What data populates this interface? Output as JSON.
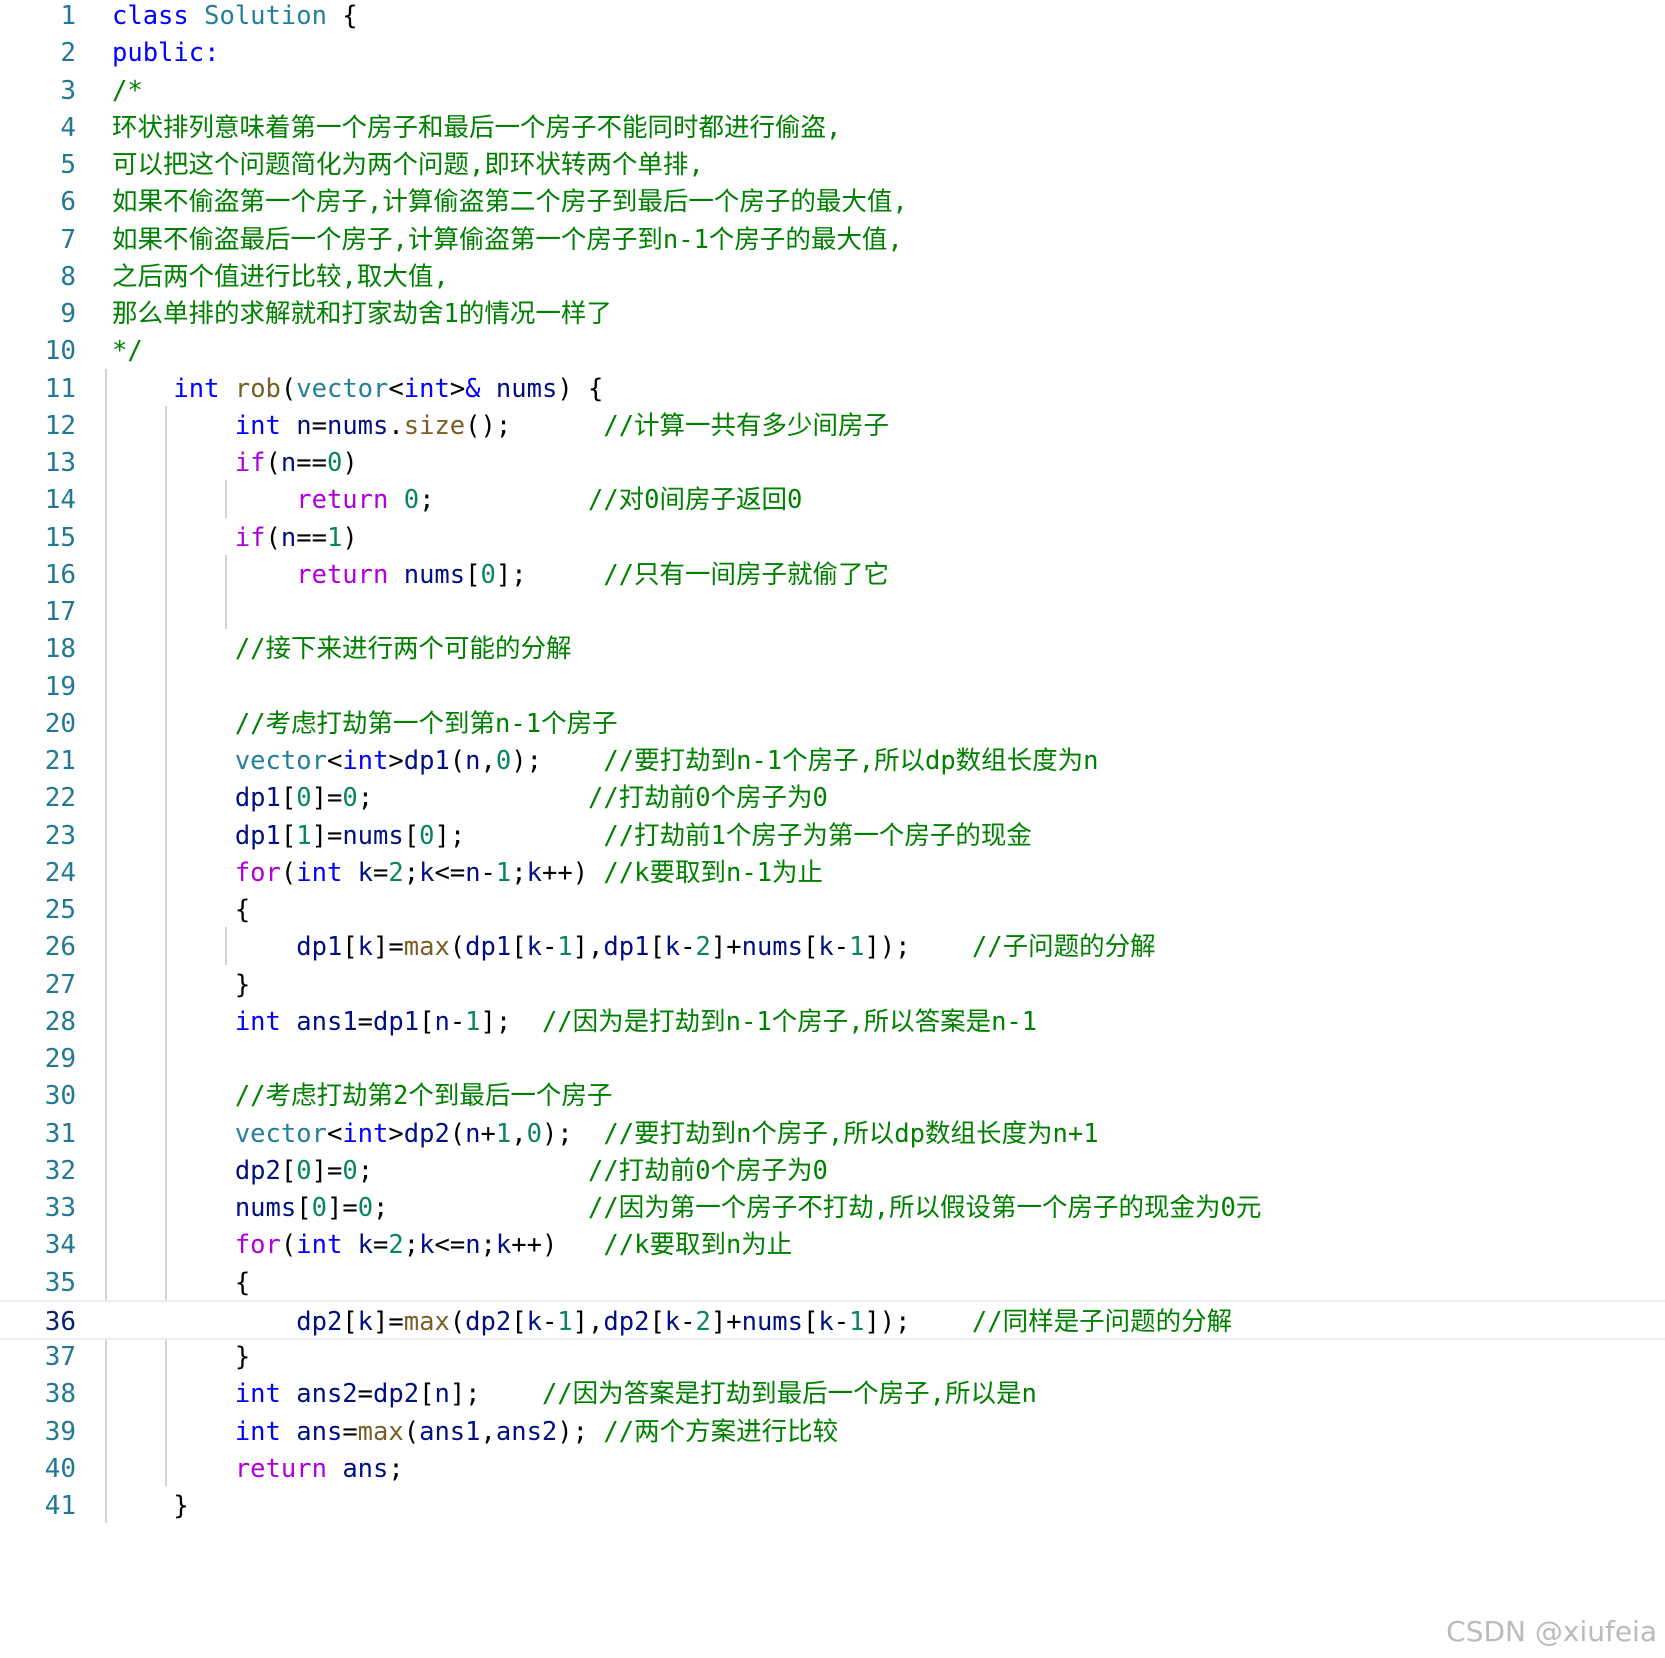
{
  "colors": {
    "keyword": "#0000ff",
    "control": "#af00db",
    "comment": "#008000",
    "type": "#267f99",
    "function": "#795e26",
    "number": "#098658",
    "variable": "#001080",
    "line_number": "#237893"
  },
  "active_line": 36,
  "watermark": "CSDN @xiufeia",
  "lines": [
    {
      "n": "1",
      "tokens": [
        [
          "kw",
          "class"
        ],
        [
          "plain",
          " "
        ],
        [
          "ty",
          "Solution"
        ],
        [
          "plain",
          " {"
        ]
      ]
    },
    {
      "n": "2",
      "tokens": [
        [
          "kw",
          "public:"
        ]
      ]
    },
    {
      "n": "3",
      "tokens": [
        [
          "cm",
          "/*"
        ]
      ]
    },
    {
      "n": "4",
      "tokens": [
        [
          "cm",
          "环状排列意味着第一个房子和最后一个房子不能同时都进行偷盗,"
        ]
      ]
    },
    {
      "n": "5",
      "tokens": [
        [
          "cm",
          "可以把这个问题简化为两个问题,即环状转两个单排,"
        ]
      ]
    },
    {
      "n": "6",
      "tokens": [
        [
          "cm",
          "如果不偷盗第一个房子,计算偷盗第二个房子到最后一个房子的最大值,"
        ]
      ]
    },
    {
      "n": "7",
      "tokens": [
        [
          "cm",
          "如果不偷盗最后一个房子,计算偷盗第一个房子到n-1个房子的最大值,"
        ]
      ]
    },
    {
      "n": "8",
      "tokens": [
        [
          "cm",
          "之后两个值进行比较,取大值,"
        ]
      ]
    },
    {
      "n": "9",
      "tokens": [
        [
          "cm",
          "那么单排的求解就和打家劫舍1的情况一样了"
        ]
      ]
    },
    {
      "n": "10",
      "tokens": [
        [
          "cm",
          "*/"
        ]
      ]
    },
    {
      "n": "11",
      "tokens": [
        [
          "plain",
          "    "
        ],
        [
          "kw",
          "int"
        ],
        [
          "plain",
          " "
        ],
        [
          "fn",
          "rob"
        ],
        [
          "plain",
          "("
        ],
        [
          "ty",
          "vector"
        ],
        [
          "plain",
          "<"
        ],
        [
          "kw",
          "int"
        ],
        [
          "plain",
          ">"
        ],
        [
          "kw",
          "&"
        ],
        [
          "plain",
          " "
        ],
        [
          "var",
          "nums"
        ],
        [
          "plain",
          ") {"
        ]
      ]
    },
    {
      "n": "12",
      "tokens": [
        [
          "plain",
          "        "
        ],
        [
          "kw",
          "int"
        ],
        [
          "plain",
          " "
        ],
        [
          "var",
          "n"
        ],
        [
          "plain",
          "="
        ],
        [
          "var",
          "nums"
        ],
        [
          "plain",
          "."
        ],
        [
          "fn",
          "size"
        ],
        [
          "plain",
          "();      "
        ],
        [
          "cm",
          "//计算一共有多少间房子"
        ]
      ]
    },
    {
      "n": "13",
      "tokens": [
        [
          "plain",
          "        "
        ],
        [
          "ctl",
          "if"
        ],
        [
          "plain",
          "("
        ],
        [
          "var",
          "n"
        ],
        [
          "plain",
          "=="
        ],
        [
          "num",
          "0"
        ],
        [
          "plain",
          ")"
        ]
      ]
    },
    {
      "n": "14",
      "tokens": [
        [
          "plain",
          "            "
        ],
        [
          "ctl",
          "return"
        ],
        [
          "plain",
          " "
        ],
        [
          "num",
          "0"
        ],
        [
          "plain",
          ";          "
        ],
        [
          "cm",
          "//对0间房子返回0"
        ]
      ]
    },
    {
      "n": "15",
      "tokens": [
        [
          "plain",
          "        "
        ],
        [
          "ctl",
          "if"
        ],
        [
          "plain",
          "("
        ],
        [
          "var",
          "n"
        ],
        [
          "plain",
          "=="
        ],
        [
          "num",
          "1"
        ],
        [
          "plain",
          ")"
        ]
      ]
    },
    {
      "n": "16",
      "tokens": [
        [
          "plain",
          "            "
        ],
        [
          "ctl",
          "return"
        ],
        [
          "plain",
          " "
        ],
        [
          "var",
          "nums"
        ],
        [
          "plain",
          "["
        ],
        [
          "num",
          "0"
        ],
        [
          "plain",
          "];     "
        ],
        [
          "cm",
          "//只有一间房子就偷了它"
        ]
      ]
    },
    {
      "n": "17",
      "tokens": []
    },
    {
      "n": "18",
      "tokens": [
        [
          "plain",
          "        "
        ],
        [
          "cm",
          "//接下来进行两个可能的分解"
        ]
      ]
    },
    {
      "n": "19",
      "tokens": []
    },
    {
      "n": "20",
      "tokens": [
        [
          "plain",
          "        "
        ],
        [
          "cm",
          "//考虑打劫第一个到第n-1个房子"
        ]
      ]
    },
    {
      "n": "21",
      "tokens": [
        [
          "plain",
          "        "
        ],
        [
          "ty",
          "vector"
        ],
        [
          "plain",
          "<"
        ],
        [
          "kw",
          "int"
        ],
        [
          "plain",
          ">"
        ],
        [
          "var",
          "dp1"
        ],
        [
          "plain",
          "("
        ],
        [
          "var",
          "n"
        ],
        [
          "plain",
          ","
        ],
        [
          "num",
          "0"
        ],
        [
          "plain",
          ");    "
        ],
        [
          "cm",
          "//要打劫到n-1个房子,所以dp数组长度为n"
        ]
      ]
    },
    {
      "n": "22",
      "tokens": [
        [
          "plain",
          "        "
        ],
        [
          "var",
          "dp1"
        ],
        [
          "plain",
          "["
        ],
        [
          "num",
          "0"
        ],
        [
          "plain",
          "]="
        ],
        [
          "num",
          "0"
        ],
        [
          "plain",
          ";              "
        ],
        [
          "cm",
          "//打劫前0个房子为0"
        ]
      ]
    },
    {
      "n": "23",
      "tokens": [
        [
          "plain",
          "        "
        ],
        [
          "var",
          "dp1"
        ],
        [
          "plain",
          "["
        ],
        [
          "num",
          "1"
        ],
        [
          "plain",
          "]="
        ],
        [
          "var",
          "nums"
        ],
        [
          "plain",
          "["
        ],
        [
          "num",
          "0"
        ],
        [
          "plain",
          "];         "
        ],
        [
          "cm",
          "//打劫前1个房子为第一个房子的现金"
        ]
      ]
    },
    {
      "n": "24",
      "tokens": [
        [
          "plain",
          "        "
        ],
        [
          "ctl",
          "for"
        ],
        [
          "plain",
          "("
        ],
        [
          "kw",
          "int"
        ],
        [
          "plain",
          " "
        ],
        [
          "var",
          "k"
        ],
        [
          "plain",
          "="
        ],
        [
          "num",
          "2"
        ],
        [
          "plain",
          ";"
        ],
        [
          "var",
          "k"
        ],
        [
          "plain",
          "<="
        ],
        [
          "var",
          "n"
        ],
        [
          "plain",
          "-"
        ],
        [
          "num",
          "1"
        ],
        [
          "plain",
          ";"
        ],
        [
          "var",
          "k"
        ],
        [
          "plain",
          "++) "
        ],
        [
          "cm",
          "//k要取到n-1为止"
        ]
      ]
    },
    {
      "n": "25",
      "tokens": [
        [
          "plain",
          "        {"
        ]
      ]
    },
    {
      "n": "26",
      "tokens": [
        [
          "plain",
          "            "
        ],
        [
          "var",
          "dp1"
        ],
        [
          "plain",
          "["
        ],
        [
          "var",
          "k"
        ],
        [
          "plain",
          "]="
        ],
        [
          "fn",
          "max"
        ],
        [
          "plain",
          "("
        ],
        [
          "var",
          "dp1"
        ],
        [
          "plain",
          "["
        ],
        [
          "var",
          "k"
        ],
        [
          "plain",
          "-"
        ],
        [
          "num",
          "1"
        ],
        [
          "plain",
          "],"
        ],
        [
          "var",
          "dp1"
        ],
        [
          "plain",
          "["
        ],
        [
          "var",
          "k"
        ],
        [
          "plain",
          "-"
        ],
        [
          "num",
          "2"
        ],
        [
          "plain",
          "]+"
        ],
        [
          "var",
          "nums"
        ],
        [
          "plain",
          "["
        ],
        [
          "var",
          "k"
        ],
        [
          "plain",
          "-"
        ],
        [
          "num",
          "1"
        ],
        [
          "plain",
          "]);    "
        ],
        [
          "cm",
          "//子问题的分解"
        ]
      ]
    },
    {
      "n": "27",
      "tokens": [
        [
          "plain",
          "        }"
        ]
      ]
    },
    {
      "n": "28",
      "tokens": [
        [
          "plain",
          "        "
        ],
        [
          "kw",
          "int"
        ],
        [
          "plain",
          " "
        ],
        [
          "var",
          "ans1"
        ],
        [
          "plain",
          "="
        ],
        [
          "var",
          "dp1"
        ],
        [
          "plain",
          "["
        ],
        [
          "var",
          "n"
        ],
        [
          "plain",
          "-"
        ],
        [
          "num",
          "1"
        ],
        [
          "plain",
          "];  "
        ],
        [
          "cm",
          "//因为是打劫到n-1个房子,所以答案是n-1"
        ]
      ]
    },
    {
      "n": "29",
      "tokens": []
    },
    {
      "n": "30",
      "tokens": [
        [
          "plain",
          "        "
        ],
        [
          "cm",
          "//考虑打劫第2个到最后一个房子"
        ]
      ]
    },
    {
      "n": "31",
      "tokens": [
        [
          "plain",
          "        "
        ],
        [
          "ty",
          "vector"
        ],
        [
          "plain",
          "<"
        ],
        [
          "kw",
          "int"
        ],
        [
          "plain",
          ">"
        ],
        [
          "var",
          "dp2"
        ],
        [
          "plain",
          "("
        ],
        [
          "var",
          "n"
        ],
        [
          "plain",
          "+"
        ],
        [
          "num",
          "1"
        ],
        [
          "plain",
          ","
        ],
        [
          "num",
          "0"
        ],
        [
          "plain",
          ");  "
        ],
        [
          "cm",
          "//要打劫到n个房子,所以dp数组长度为n+1"
        ]
      ]
    },
    {
      "n": "32",
      "tokens": [
        [
          "plain",
          "        "
        ],
        [
          "var",
          "dp2"
        ],
        [
          "plain",
          "["
        ],
        [
          "num",
          "0"
        ],
        [
          "plain",
          "]="
        ],
        [
          "num",
          "0"
        ],
        [
          "plain",
          ";              "
        ],
        [
          "cm",
          "//打劫前0个房子为0"
        ]
      ]
    },
    {
      "n": "33",
      "tokens": [
        [
          "plain",
          "        "
        ],
        [
          "var",
          "nums"
        ],
        [
          "plain",
          "["
        ],
        [
          "num",
          "0"
        ],
        [
          "plain",
          "]="
        ],
        [
          "num",
          "0"
        ],
        [
          "plain",
          ";             "
        ],
        [
          "cm",
          "//因为第一个房子不打劫,所以假设第一个房子的现金为0元"
        ]
      ]
    },
    {
      "n": "34",
      "tokens": [
        [
          "plain",
          "        "
        ],
        [
          "ctl",
          "for"
        ],
        [
          "plain",
          "("
        ],
        [
          "kw",
          "int"
        ],
        [
          "plain",
          " "
        ],
        [
          "var",
          "k"
        ],
        [
          "plain",
          "="
        ],
        [
          "num",
          "2"
        ],
        [
          "plain",
          ";"
        ],
        [
          "var",
          "k"
        ],
        [
          "plain",
          "<="
        ],
        [
          "var",
          "n"
        ],
        [
          "plain",
          ";"
        ],
        [
          "var",
          "k"
        ],
        [
          "plain",
          "++)   "
        ],
        [
          "cm",
          "//k要取到n为止"
        ]
      ]
    },
    {
      "n": "35",
      "tokens": [
        [
          "plain",
          "        {"
        ]
      ]
    },
    {
      "n": "36",
      "tokens": [
        [
          "plain",
          "            "
        ],
        [
          "var",
          "dp2"
        ],
        [
          "plain",
          "["
        ],
        [
          "var",
          "k"
        ],
        [
          "plain",
          "]="
        ],
        [
          "fn",
          "max"
        ],
        [
          "plain",
          "("
        ],
        [
          "var",
          "dp2"
        ],
        [
          "plain",
          "["
        ],
        [
          "var",
          "k"
        ],
        [
          "plain",
          "-"
        ],
        [
          "num",
          "1"
        ],
        [
          "plain",
          "],"
        ],
        [
          "var",
          "dp2"
        ],
        [
          "plain",
          "["
        ],
        [
          "var",
          "k"
        ],
        [
          "plain",
          "-"
        ],
        [
          "num",
          "2"
        ],
        [
          "plain",
          "]+"
        ],
        [
          "var",
          "nums"
        ],
        [
          "plain",
          "["
        ],
        [
          "var",
          "k"
        ],
        [
          "plain",
          "-"
        ],
        [
          "num",
          "1"
        ],
        [
          "plain",
          "]);    "
        ],
        [
          "cm",
          "//同样是子问题的分解"
        ]
      ]
    },
    {
      "n": "37",
      "tokens": [
        [
          "plain",
          "        }"
        ]
      ]
    },
    {
      "n": "38",
      "tokens": [
        [
          "plain",
          "        "
        ],
        [
          "kw",
          "int"
        ],
        [
          "plain",
          " "
        ],
        [
          "var",
          "ans2"
        ],
        [
          "plain",
          "="
        ],
        [
          "var",
          "dp2"
        ],
        [
          "plain",
          "["
        ],
        [
          "var",
          "n"
        ],
        [
          "plain",
          "];    "
        ],
        [
          "cm",
          "//因为答案是打劫到最后一个房子,所以是n"
        ]
      ]
    },
    {
      "n": "39",
      "tokens": [
        [
          "plain",
          "        "
        ],
        [
          "kw",
          "int"
        ],
        [
          "plain",
          " "
        ],
        [
          "var",
          "ans"
        ],
        [
          "plain",
          "="
        ],
        [
          "fn",
          "max"
        ],
        [
          "plain",
          "("
        ],
        [
          "var",
          "ans1"
        ],
        [
          "plain",
          ","
        ],
        [
          "var",
          "ans2"
        ],
        [
          "plain",
          "); "
        ],
        [
          "cm",
          "//两个方案进行比较"
        ]
      ]
    },
    {
      "n": "40",
      "tokens": [
        [
          "plain",
          "        "
        ],
        [
          "ctl",
          "return"
        ],
        [
          "plain",
          " "
        ],
        [
          "var",
          "ans"
        ],
        [
          "plain",
          ";"
        ]
      ]
    },
    {
      "n": "41",
      "tokens": [
        [
          "plain",
          "    }"
        ]
      ]
    }
  ]
}
